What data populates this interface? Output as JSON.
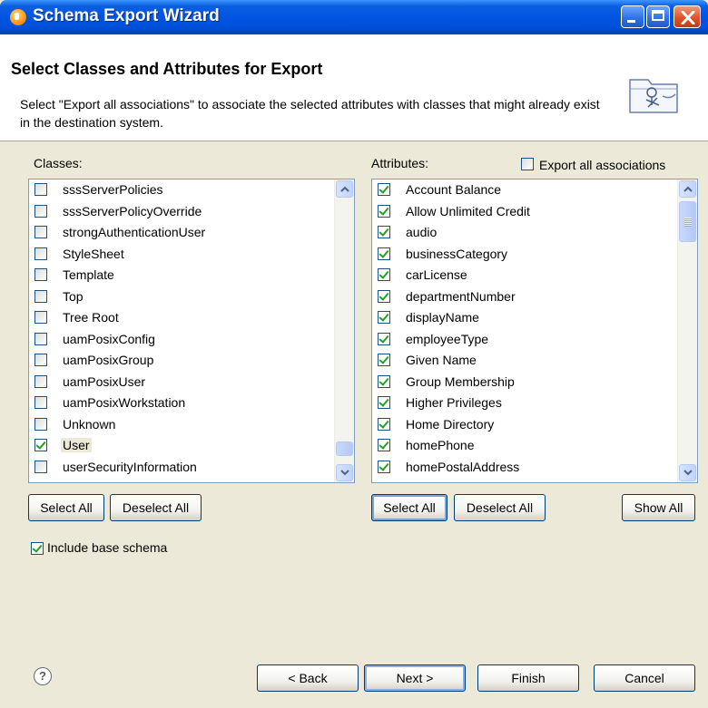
{
  "window": {
    "title": "Schema Export Wizard"
  },
  "header": {
    "title": "Select Classes and Attributes for Export",
    "description": "Select \"Export all associations\" to associate the selected attributes with classes that might already exist in the destination system."
  },
  "classes": {
    "label": "Classes:",
    "items": [
      {
        "label": "sssServerPolicies",
        "checked": false
      },
      {
        "label": "sssServerPolicyOverride",
        "checked": false
      },
      {
        "label": "strongAuthenticationUser",
        "checked": false
      },
      {
        "label": "StyleSheet",
        "checked": false
      },
      {
        "label": "Template",
        "checked": false
      },
      {
        "label": "Top",
        "checked": false
      },
      {
        "label": "Tree Root",
        "checked": false
      },
      {
        "label": "uamPosixConfig",
        "checked": false
      },
      {
        "label": "uamPosixGroup",
        "checked": false
      },
      {
        "label": "uamPosixUser",
        "checked": false
      },
      {
        "label": "uamPosixWorkstation",
        "checked": false
      },
      {
        "label": "Unknown",
        "checked": false
      },
      {
        "label": "User",
        "checked": true,
        "selected": true
      },
      {
        "label": "userSecurityInformation",
        "checked": false
      }
    ],
    "select_all": "Select All",
    "deselect_all": "Deselect All"
  },
  "attributes": {
    "label": "Attributes:",
    "export_all_label": "Export all associations",
    "export_all_checked": false,
    "items": [
      {
        "label": "Account Balance",
        "checked": true
      },
      {
        "label": "Allow Unlimited Credit",
        "checked": true
      },
      {
        "label": "audio",
        "checked": true
      },
      {
        "label": "businessCategory",
        "checked": true
      },
      {
        "label": "carLicense",
        "checked": true
      },
      {
        "label": "departmentNumber",
        "checked": true
      },
      {
        "label": "displayName",
        "checked": true
      },
      {
        "label": "employeeType",
        "checked": true
      },
      {
        "label": "Given Name",
        "checked": true
      },
      {
        "label": "Group Membership",
        "checked": true
      },
      {
        "label": "Higher Privileges",
        "checked": true
      },
      {
        "label": "Home Directory",
        "checked": true
      },
      {
        "label": "homePhone",
        "checked": true
      },
      {
        "label": "homePostalAddress",
        "checked": true
      }
    ],
    "select_all": "Select All",
    "deselect_all": "Deselect All",
    "show_all": "Show All"
  },
  "include_base_schema": {
    "label": "Include base schema",
    "checked": true
  },
  "footer": {
    "help_glyph": "?",
    "back": "< Back",
    "next": "Next >",
    "finish": "Finish",
    "cancel": "Cancel"
  },
  "icons": {
    "app": "wizard-app-icon",
    "header": "schema-export-image",
    "help": "help-icon"
  },
  "colors": {
    "titlebar": "#0054e3",
    "dialog_bg": "#ece9d8",
    "check": "#21a121",
    "listbox_border": "#7f9db9"
  }
}
